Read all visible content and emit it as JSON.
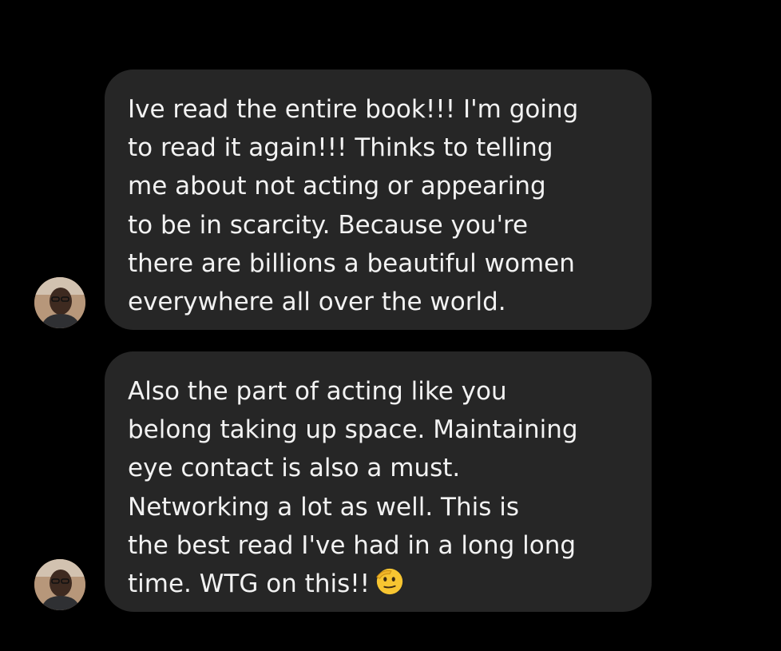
{
  "messages": [
    {
      "lines": [
        "Ive read the entire book!!! I'm going",
        "to read it again!!! Thinks to telling",
        "me about not acting or appearing",
        "to be in scarcity. Because you're",
        "there are billions a beautiful women",
        "everywhere all over the world."
      ],
      "avatar_icon": "user-avatar"
    },
    {
      "lines": [
        "Also the part of acting like you",
        "belong taking up space. Maintaining",
        "eye contact is also a must.",
        "Networking a lot as well. This is",
        "the best read I've had in a long long",
        "time. WTG on this!!"
      ],
      "trailing_emoji": "saluting-face-emoji",
      "avatar_icon": "user-avatar"
    }
  ],
  "colors": {
    "background": "#000000",
    "bubble": "#262626",
    "text": "#f2f2f2"
  }
}
